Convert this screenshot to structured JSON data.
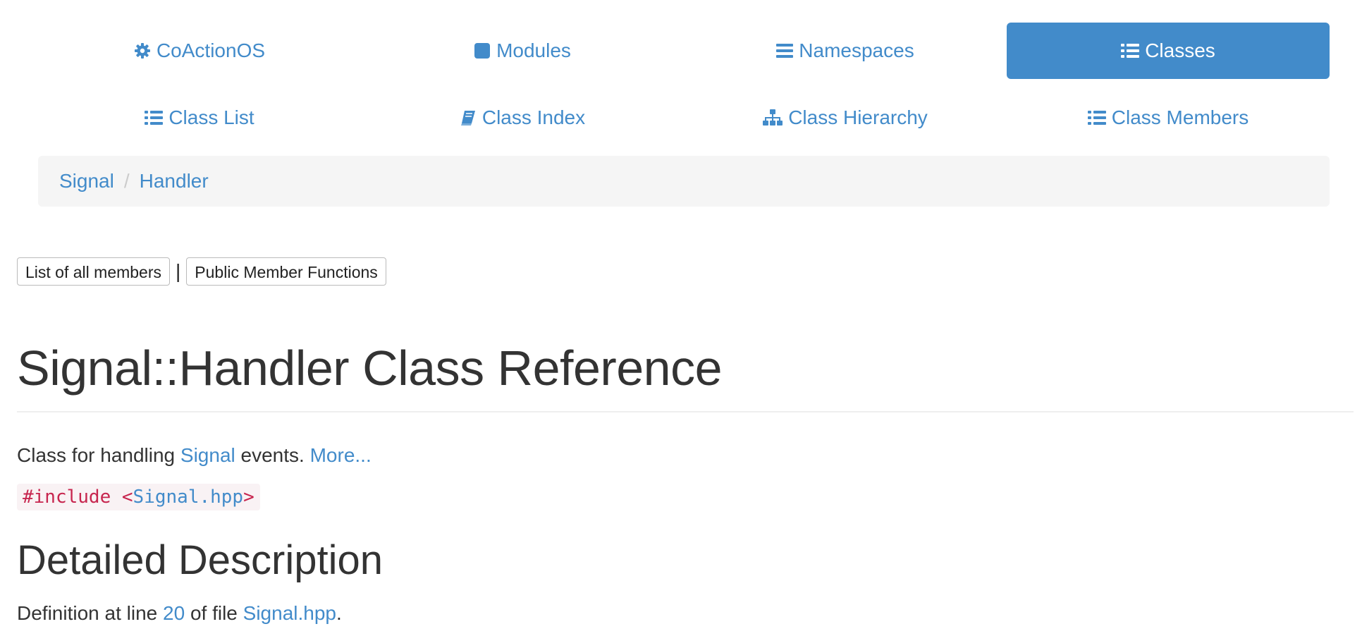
{
  "nav_primary": [
    {
      "label": "CoActionOS",
      "icon": "gear-icon",
      "active": false
    },
    {
      "label": "Modules",
      "icon": "square-icon",
      "active": false
    },
    {
      "label": "Namespaces",
      "icon": "bars-icon",
      "active": false
    },
    {
      "label": "Classes",
      "icon": "list-icon",
      "active": true
    }
  ],
  "nav_secondary": [
    {
      "label": "Class List",
      "icon": "list-icon"
    },
    {
      "label": "Class Index",
      "icon": "book-icon"
    },
    {
      "label": "Class Hierarchy",
      "icon": "sitemap-icon"
    },
    {
      "label": "Class Members",
      "icon": "list-icon"
    }
  ],
  "breadcrumb": {
    "items": [
      "Signal",
      "Handler"
    ],
    "separator": "/"
  },
  "summary": {
    "all_members": "List of all members",
    "separator": "|",
    "public_functions": "Public Member Functions"
  },
  "title": "Signal::Handler Class Reference",
  "brief": {
    "prefix": "Class for handling ",
    "link": "Signal",
    "suffix": " events. ",
    "more": "More..."
  },
  "include": {
    "directive": "#include <",
    "file": "Signal.hpp",
    "close": ">"
  },
  "detailed_heading": "Detailed Description",
  "definition": {
    "prefix": "Definition at line ",
    "line": "20",
    "middle": " of file ",
    "file": "Signal.hpp",
    "suffix": "."
  },
  "colors": {
    "accent": "#428bca",
    "breadcrumb_bg": "#f5f5f5",
    "code_text": "#c7254e",
    "code_bg": "#f9f2f4",
    "heading_text": "#333333"
  }
}
